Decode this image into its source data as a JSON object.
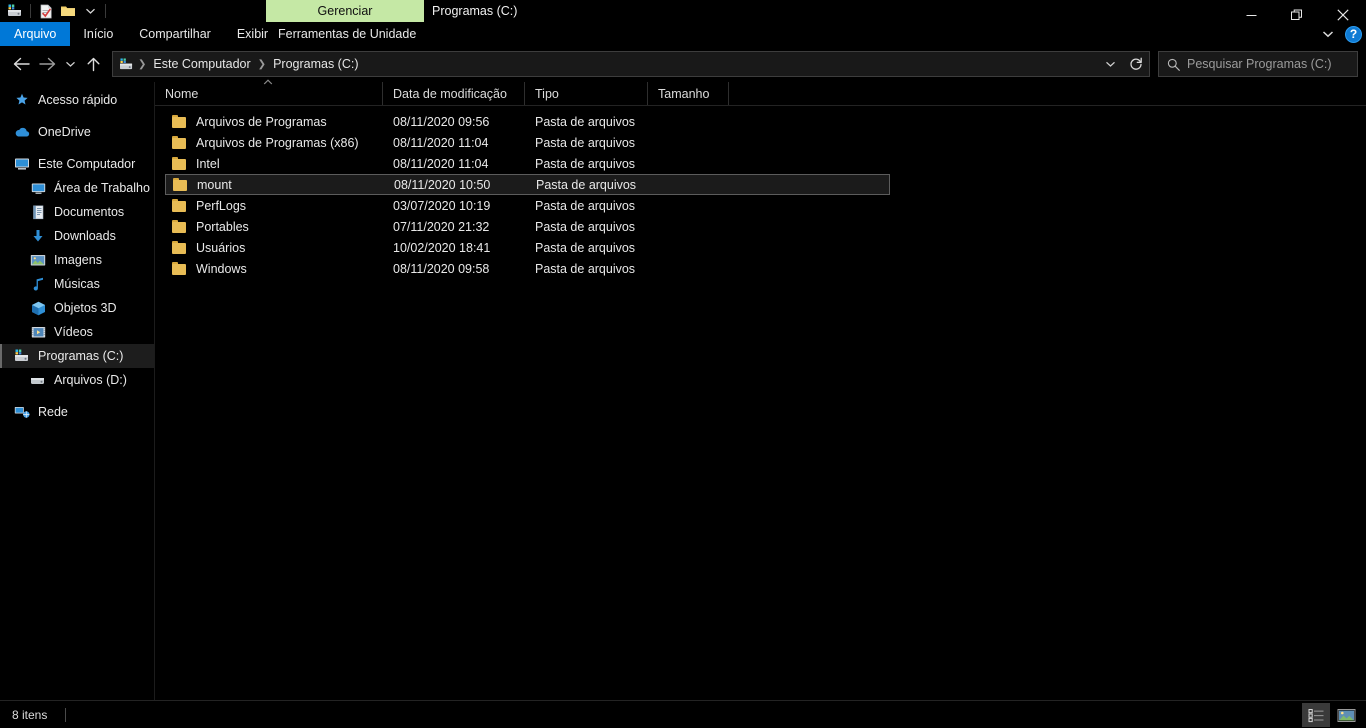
{
  "window": {
    "title": "Programas (C:)",
    "contextual_tab_group": "Gerenciar",
    "minimize_label": "Minimizar",
    "restore_label": "Restaurar",
    "close_label": "Fechar"
  },
  "quick_access_toolbar": {
    "items": [
      {
        "name": "drive-icon",
        "label": "Programas (C:)"
      },
      {
        "name": "properties-icon",
        "label": "Propriedades"
      },
      {
        "name": "new-folder-icon",
        "label": "Nova pasta"
      },
      {
        "name": "chevron-down-icon",
        "label": "Personalizar Barra de Ferramentas de Acesso Rápido"
      }
    ]
  },
  "ribbon": {
    "tabs": [
      {
        "label": "Arquivo",
        "selected": true
      },
      {
        "label": "Início",
        "selected": false
      },
      {
        "label": "Compartilhar",
        "selected": false
      },
      {
        "label": "Exibir",
        "selected": false
      }
    ],
    "contextual_tab": {
      "label": "Ferramentas de Unidade"
    },
    "collapse_label": "Minimizar a Faixa de Opções",
    "help_label": "?"
  },
  "navigation": {
    "back_label": "Voltar",
    "forward_label": "Avançar",
    "recent_label": "Locais recentes",
    "up_label": "Acima",
    "address_dropdown_label": "Locais anteriores",
    "refresh_label": "Atualizar"
  },
  "address": {
    "breadcrumbs": [
      {
        "label": "Este Computador"
      },
      {
        "label": "Programas (C:)"
      }
    ]
  },
  "search": {
    "placeholder": "Pesquisar Programas (C:)",
    "icon": "search-icon"
  },
  "sidebar": {
    "items": [
      {
        "label": "Acesso rápido",
        "icon": "star-icon",
        "level": 0,
        "selected": false,
        "gap": false
      },
      {
        "label": "OneDrive",
        "icon": "cloud-icon",
        "level": 0,
        "selected": false,
        "gap": true
      },
      {
        "label": "Este Computador",
        "icon": "computer-icon",
        "level": 0,
        "selected": false,
        "gap": true
      },
      {
        "label": "Área de Trabalho",
        "icon": "desktop-icon",
        "level": 1,
        "selected": false,
        "gap": false
      },
      {
        "label": "Documentos",
        "icon": "documents-icon",
        "level": 1,
        "selected": false,
        "gap": false
      },
      {
        "label": "Downloads",
        "icon": "download-icon",
        "level": 1,
        "selected": false,
        "gap": false
      },
      {
        "label": "Imagens",
        "icon": "pictures-icon",
        "level": 1,
        "selected": false,
        "gap": false
      },
      {
        "label": "Músicas",
        "icon": "music-icon",
        "level": 1,
        "selected": false,
        "gap": false
      },
      {
        "label": "Objetos 3D",
        "icon": "3d-objects-icon",
        "level": 1,
        "selected": false,
        "gap": false
      },
      {
        "label": "Vídeos",
        "icon": "videos-icon",
        "level": 1,
        "selected": false,
        "gap": false
      },
      {
        "label": "Programas (C:)",
        "icon": "local-drive-icon",
        "level": 1,
        "selected": true,
        "gap": false
      },
      {
        "label": "Arquivos (D:)",
        "icon": "drive-icon",
        "level": 1,
        "selected": false,
        "gap": false
      },
      {
        "label": "Rede",
        "icon": "network-icon",
        "level": 0,
        "selected": false,
        "gap": true
      }
    ]
  },
  "file_list": {
    "columns": [
      {
        "label": "Nome",
        "key": "name",
        "sorted": "asc"
      },
      {
        "label": "Data de modificação",
        "key": "date",
        "sorted": null
      },
      {
        "label": "Tipo",
        "key": "type",
        "sorted": null
      },
      {
        "label": "Tamanho",
        "key": "size",
        "sorted": null
      }
    ],
    "rows": [
      {
        "name": "Arquivos de Programas",
        "date": "08/11/2020 09:56",
        "type": "Pasta de arquivos",
        "size": "",
        "icon": "folder-icon",
        "selected": false
      },
      {
        "name": "Arquivos de Programas (x86)",
        "date": "08/11/2020 11:04",
        "type": "Pasta de arquivos",
        "size": "",
        "icon": "folder-icon",
        "selected": false
      },
      {
        "name": "Intel",
        "date": "08/11/2020 11:04",
        "type": "Pasta de arquivos",
        "size": "",
        "icon": "folder-icon",
        "selected": false
      },
      {
        "name": "mount",
        "date": "08/11/2020 10:50",
        "type": "Pasta de arquivos",
        "size": "",
        "icon": "folder-icon",
        "selected": true
      },
      {
        "name": "PerfLogs",
        "date": "03/07/2020 10:19",
        "type": "Pasta de arquivos",
        "size": "",
        "icon": "folder-icon",
        "selected": false
      },
      {
        "name": "Portables",
        "date": "07/11/2020 21:32",
        "type": "Pasta de arquivos",
        "size": "",
        "icon": "folder-icon",
        "selected": false
      },
      {
        "name": "Usuários",
        "date": "10/02/2020 18:41",
        "type": "Pasta de arquivos",
        "size": "",
        "icon": "folder-icon",
        "selected": false
      },
      {
        "name": "Windows",
        "date": "08/11/2020 09:58",
        "type": "Pasta de arquivos",
        "size": "",
        "icon": "folder-icon",
        "selected": false
      }
    ]
  },
  "status_bar": {
    "item_count": "8 itens",
    "view_details_label": "Detalhes",
    "view_large_icons_label": "Ícones grandes"
  },
  "colors": {
    "accent_blue": "#0078d7",
    "contextual_green": "#c5e8a5",
    "folder_yellow": "#e8bc55",
    "background": "#000000",
    "text": "#e9e9e9"
  }
}
